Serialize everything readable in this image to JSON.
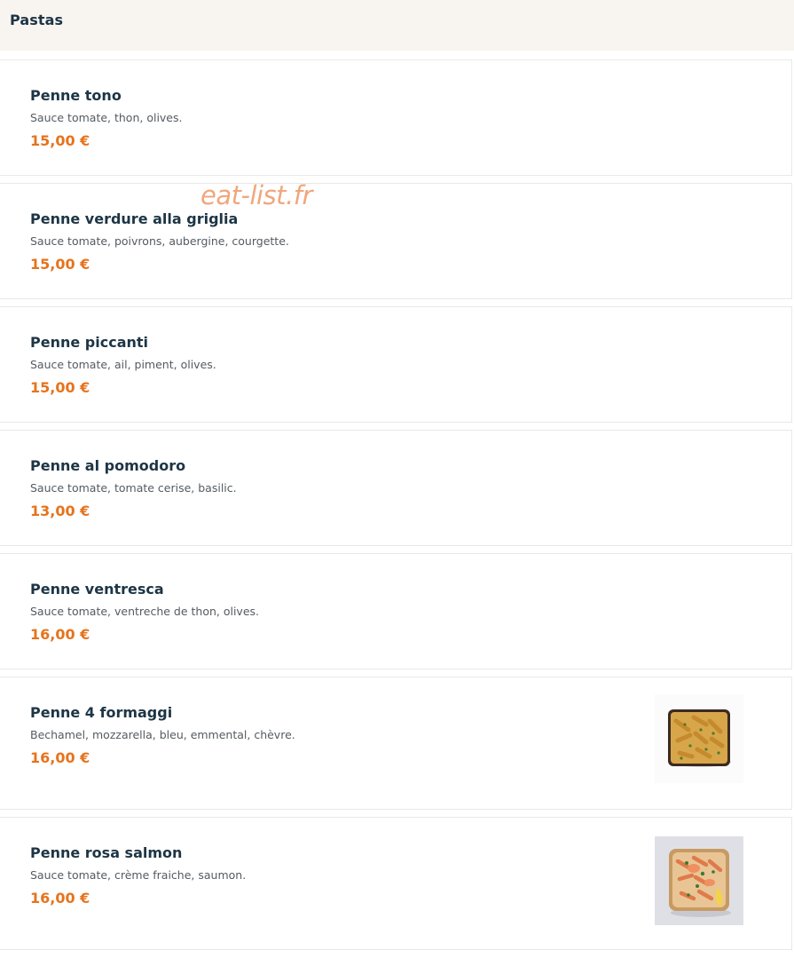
{
  "section": {
    "title": "Pastas"
  },
  "watermark": "eat-list.fr",
  "items": [
    {
      "name": "Penne tono",
      "description": "Sauce tomate, thon, olives.",
      "price": "15,00 €"
    },
    {
      "name": "Penne verdure alla griglia",
      "description": "Sauce tomate, poivrons, aubergine, courgette.",
      "price": "15,00 €"
    },
    {
      "name": "Penne piccanti",
      "description": "Sauce tomate, ail, piment, olives.",
      "price": "15,00 €"
    },
    {
      "name": "Penne al pomodoro",
      "description": "Sauce tomate, tomate cerise, basilic.",
      "price": "13,00 €"
    },
    {
      "name": "Penne ventresca",
      "description": "Sauce tomate, ventreche de thon, olives.",
      "price": "16,00 €"
    },
    {
      "name": "Penne 4 formaggi",
      "description": "Bechamel, mozzarella, bleu, emmental, chèvre.",
      "price": "16,00 €",
      "image": "pasta-4-formaggi-photo"
    },
    {
      "name": "Penne rosa salmon",
      "description": "Sauce tomate, crème fraiche, saumon.",
      "price": "16,00 €",
      "image": "pasta-rosa-salmon-photo"
    }
  ],
  "colors": {
    "header_bg": "#f8f5f1",
    "title": "#1d3545",
    "price": "#e6731c",
    "watermark": "#f0a77d"
  }
}
